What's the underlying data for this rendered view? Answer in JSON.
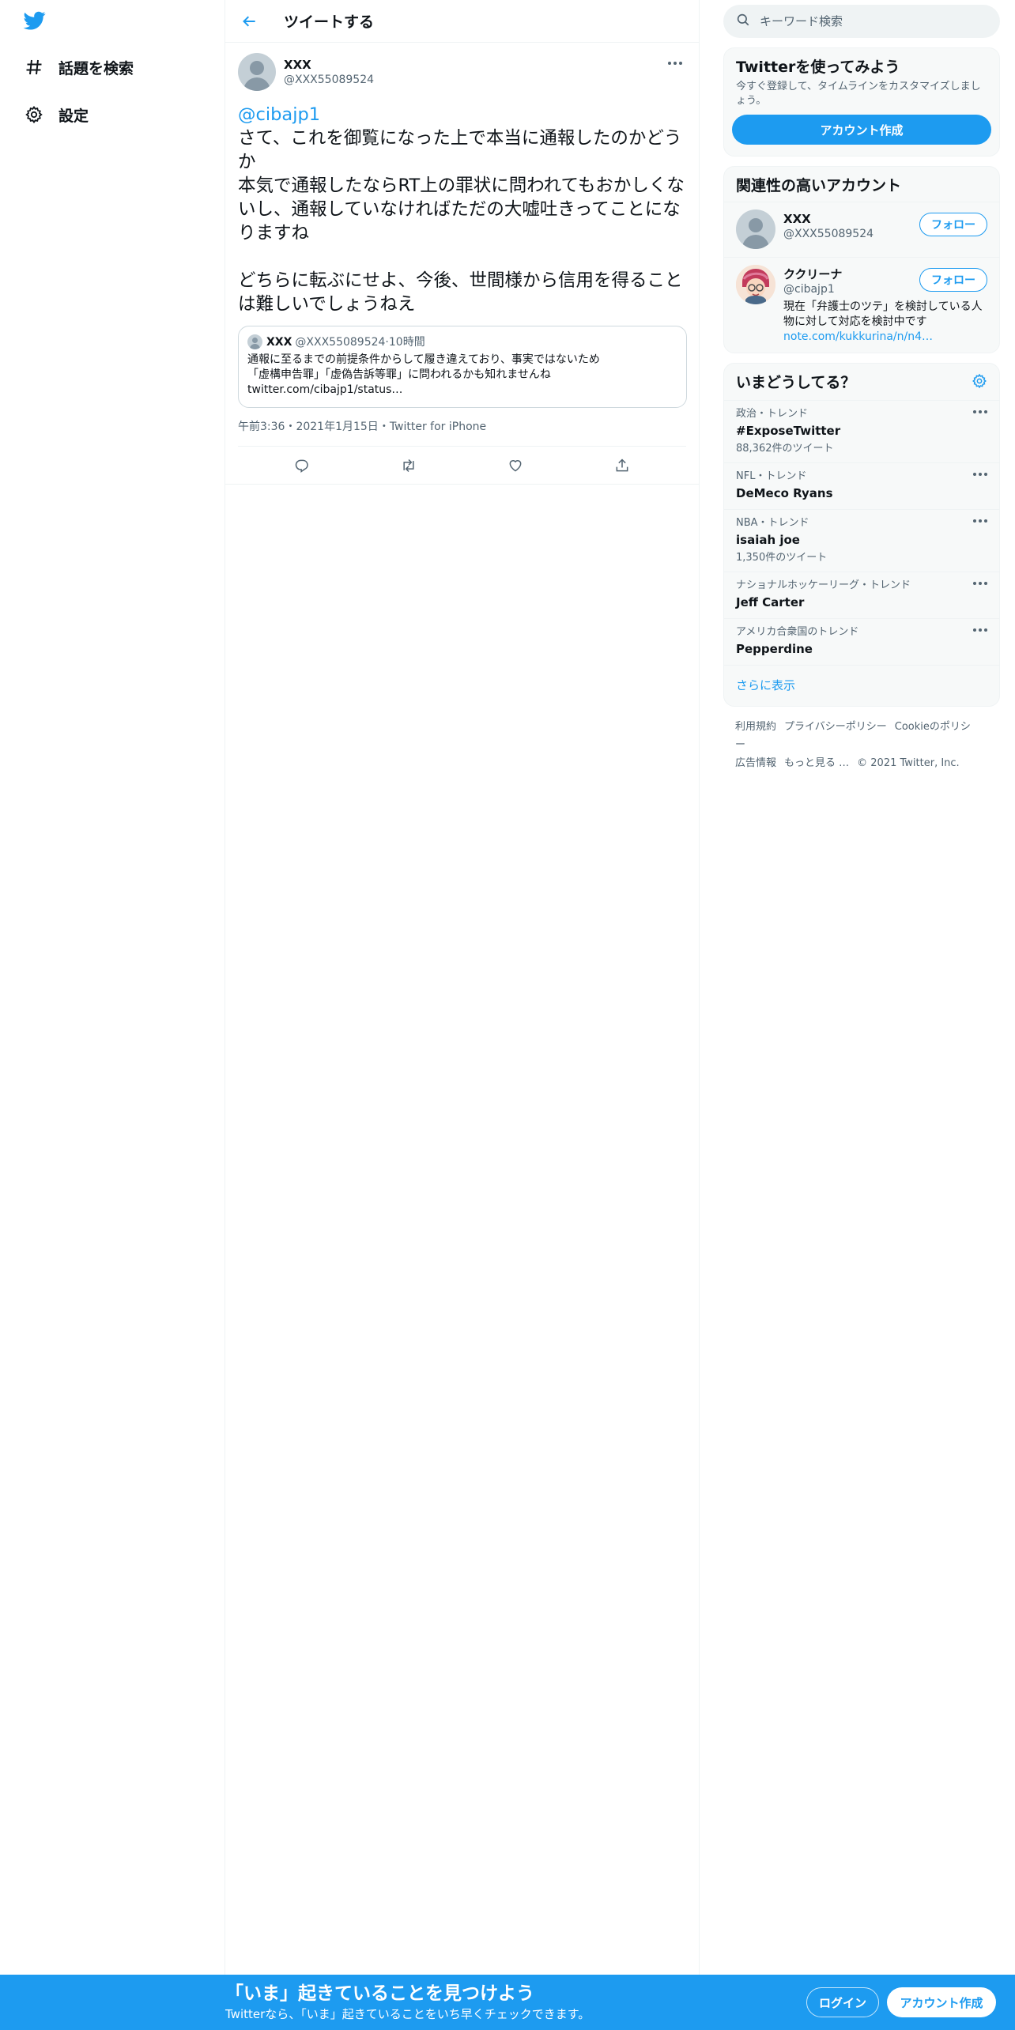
{
  "nav": {
    "logo_icon": "twitter-bird-icon",
    "items": [
      {
        "icon": "hashtag-icon",
        "label": "話題を検索"
      },
      {
        "icon": "gear-icon",
        "label": "設定"
      }
    ]
  },
  "header": {
    "back_icon": "arrow-left-icon",
    "title": "ツイートする"
  },
  "tweet": {
    "author": {
      "name": "XXX",
      "handle": "@XXX55089524"
    },
    "mention": "@cibajp1",
    "text": "\nさて、これを御覧になった上で本当に通報したのかどうか\n本気で通報したならRT上の罪状に問われてもおかしくないし、通報していなければただの大嘘吐きってことになりますね\n\nどちらに転ぶにせよ、今後、世間様から信用を得ることは難しいでしょうねえ",
    "quote": {
      "name": "XXX",
      "handle": "@XXX55089524",
      "time": "10時間",
      "separator": " · ",
      "text": "通報に至るまでの前提条件からして履き違えており、事実ではないため\n「虚構申告罪」「虚偽告訴等罪」に問われるかも知れませんね\ntwitter.com/cibajp1/status…"
    },
    "time": "午前3:36",
    "date": "2021年1月15日",
    "source": "Twitter for iPhone",
    "dot": "・",
    "actions": [
      "reply-icon",
      "retweet-icon",
      "like-icon",
      "share-icon"
    ]
  },
  "search": {
    "placeholder": "キーワード検索",
    "icon": "search-icon"
  },
  "signup_card": {
    "title": "Twitterを使ってみよう",
    "desc": "今すぐ登録して、タイムラインをカスタマイズしましょう。",
    "button": "アカウント作成"
  },
  "relevant": {
    "title": "関連性の高いアカウント",
    "accounts": [
      {
        "name": "XXX",
        "handle": "@XXX55089524",
        "bio": "",
        "link": "",
        "follow": "フォロー"
      },
      {
        "name": "ククリーナ",
        "handle": "@cibajp1",
        "bio": "現在「弁護士のツテ」を検討している人物に対して対応を検討中です",
        "link": "note.com/kukkurina/n/n4…",
        "follow": "フォロー"
      }
    ]
  },
  "trends": {
    "title": "いまどうしてる？",
    "settings_icon": "gear-icon",
    "items": [
      {
        "category": "政治・トレンド",
        "name": "#ExposeTwitter",
        "count": "88,362件のツイート"
      },
      {
        "category": "NFL・トレンド",
        "name": "DeMeco Ryans",
        "count": ""
      },
      {
        "category": "NBA・トレンド",
        "name": "isaiah joe",
        "count": "1,350件のツイート"
      },
      {
        "category": "ナショナルホッケーリーグ・トレンド",
        "name": "Jeff Carter",
        "count": ""
      },
      {
        "category": "アメリカ合衆国のトレンド",
        "name": "Pepperdine",
        "count": ""
      }
    ],
    "show_more": "さらに表示"
  },
  "footer": {
    "links": [
      "利用規約",
      "プライバシーポリシー",
      "Cookieのポリシー",
      "広告情報",
      "もっと見る …"
    ],
    "copyright": "© 2021 Twitter, Inc."
  },
  "banner": {
    "title": "「いま」起きていることを見つけよう",
    "subtitle": "Twitterなら、「いま」起きていることをいち早くチェックできます。",
    "login": "ログイン",
    "signup": "アカウント作成"
  },
  "colors": {
    "accent": "#1d9bf0",
    "text": "#0f1419",
    "secondary": "#536471",
    "border": "#eff3f4"
  }
}
